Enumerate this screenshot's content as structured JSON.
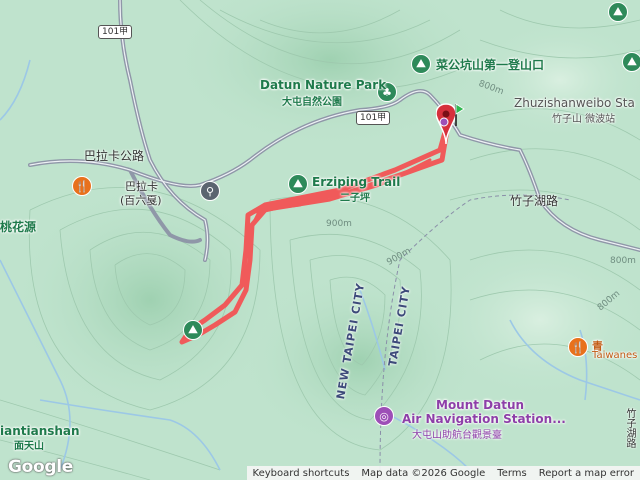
{
  "colors": {
    "terrain": "#bfe3cd",
    "route": "#f05a5a",
    "road": "#8f97a8",
    "stream": "#9cc8e6"
  },
  "pois": {
    "caigong": "菜公坑山第一登山口",
    "nature_park_en": "Datun Nature Park",
    "nature_park_cn": "大屯自然公園",
    "zhuzi_en": "Zhuzishanweibo Sta",
    "zhuzi_cn": "竹子山 微波站",
    "balaka_cn": "巴拉卡",
    "balaka_alt": "(百六戛)",
    "erziping": "Erziping Trail",
    "erziping_cn": "二子坪",
    "taohuayuan": "桃花源",
    "miantian_en": "iantianshan",
    "miantian_cn": "面天山",
    "mount_datun": "Mount Datun",
    "air_nav": "Air Navigation Station...",
    "air_nav_cn": "大屯山助航台觀景臺",
    "taiwanese_cn": "青",
    "taiwanese_en": "Taiwanes"
  },
  "roads": {
    "balaka_rd": "巴拉卡公路",
    "zhuzihu_rd": "竹子湖路",
    "zhuzihu_rd_v": "竹子湖路",
    "shield_1": "101甲",
    "shield_2": "101甲"
  },
  "boundaries": {
    "new_taipei": "NEW TAIPEI CITY",
    "taipei": "TAIPEI CITY"
  },
  "elevations": {
    "e1": "900m",
    "e2": "900m",
    "e3": "800m",
    "e4": "800m",
    "e5": "800m"
  },
  "attribution": {
    "logo": "Google",
    "keyboard": "Keyboard shortcuts",
    "mapdata": "Map data ©2026 Google",
    "terms": "Terms",
    "report": "Report a map error"
  },
  "icons": {
    "trailhead": "green-hiker-icon",
    "restaurant": "restaurant-icon",
    "bus": "bus-stop-icon",
    "park": "park-tree-icon",
    "landmark": "landmark-icon",
    "start_flag": "start-flag-icon",
    "end_pin": "end-pin-icon"
  }
}
